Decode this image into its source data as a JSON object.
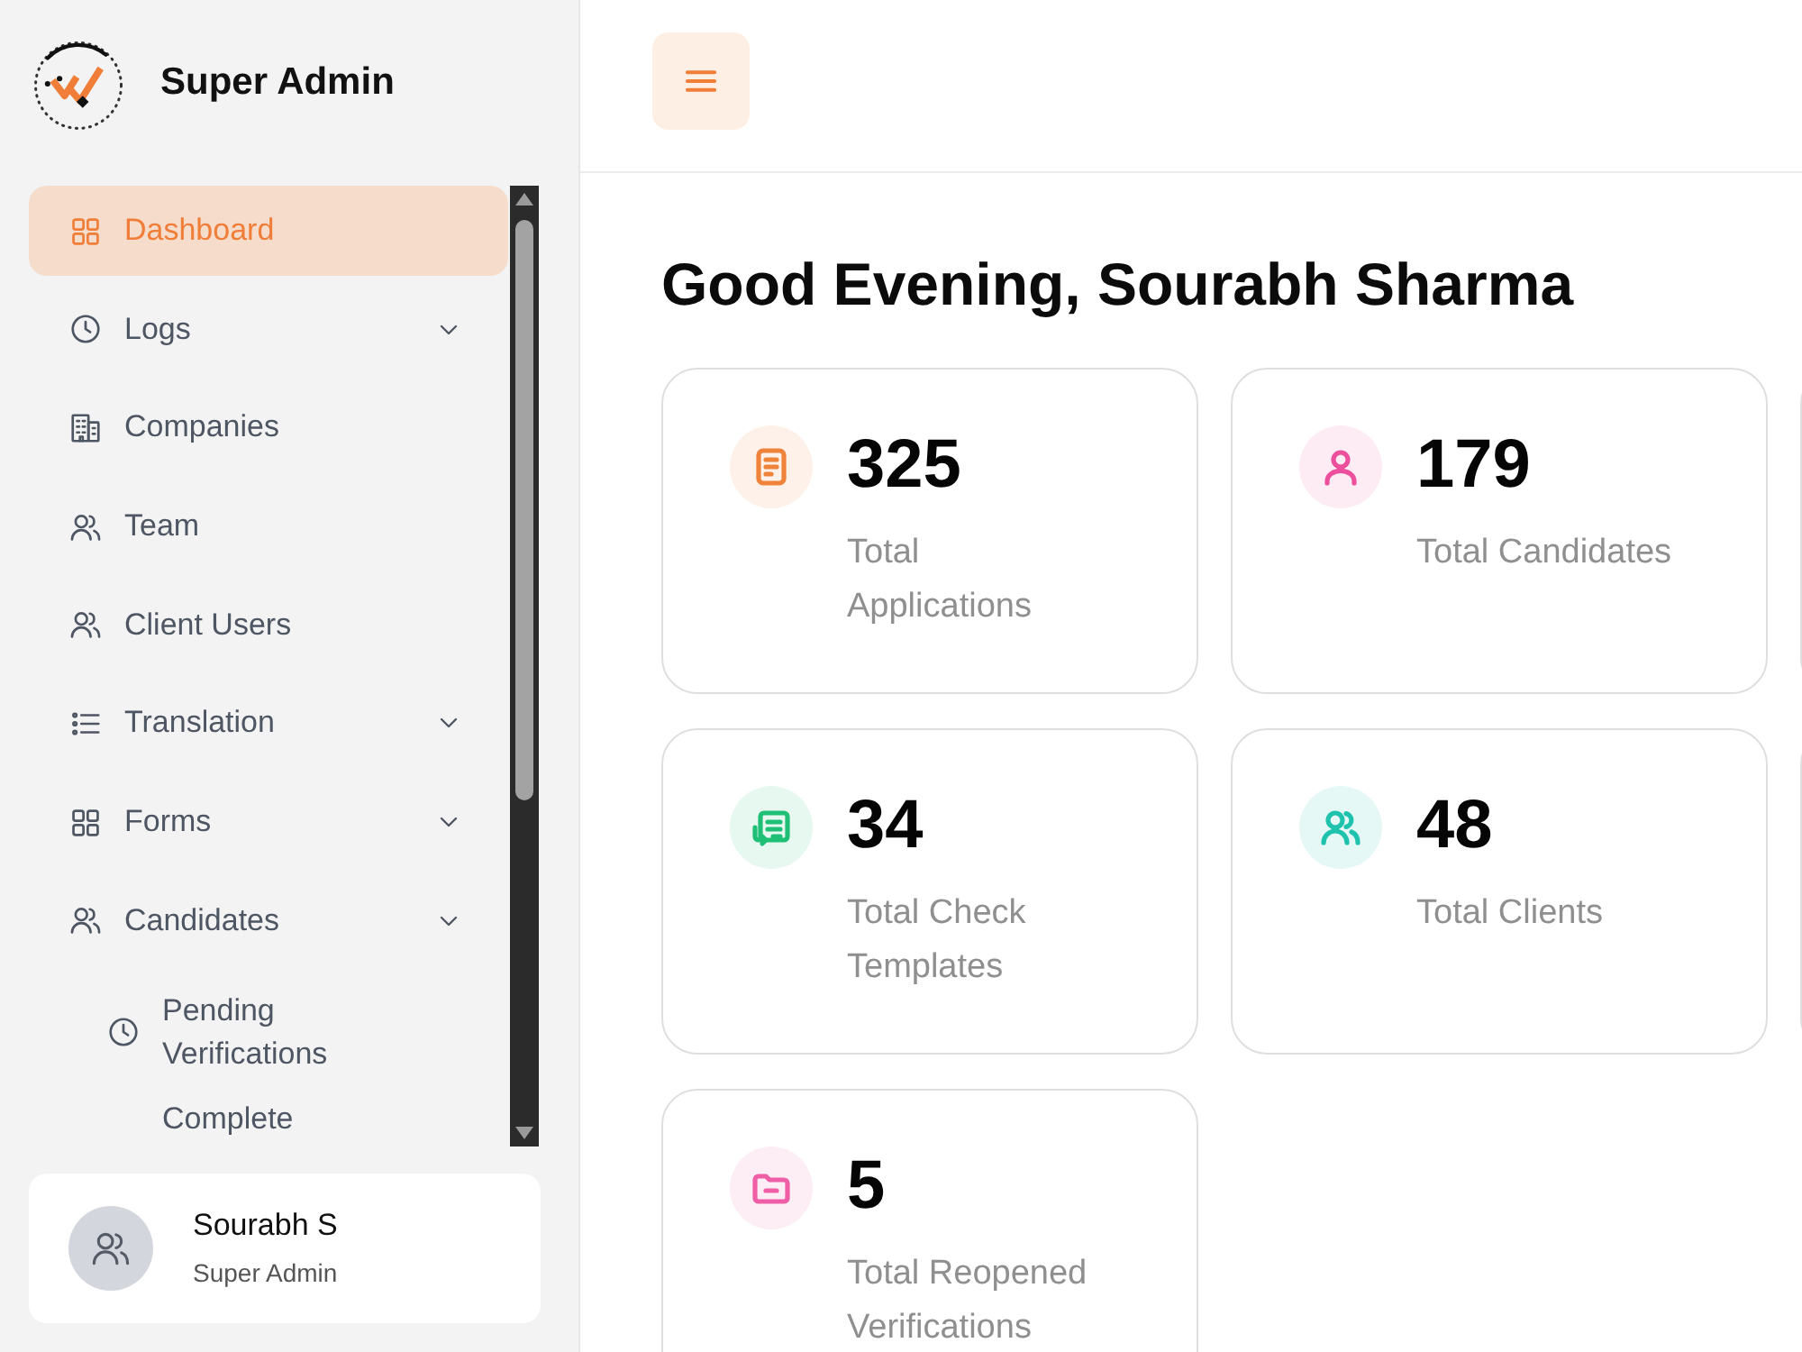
{
  "sidebar": {
    "brand": {
      "title": "Super Admin"
    },
    "nav": [
      {
        "label": "Dashboard",
        "kind": "link",
        "selected": true
      },
      {
        "label": "Logs",
        "kind": "menu",
        "selected": false
      },
      {
        "label": "Companies",
        "kind": "link",
        "selected": false
      },
      {
        "label": "Team",
        "kind": "link",
        "selected": false
      },
      {
        "label": "Client Users",
        "kind": "link",
        "selected": false
      },
      {
        "label": "Translation",
        "kind": "menu",
        "selected": false
      },
      {
        "label": "Forms",
        "kind": "menu",
        "selected": false
      },
      {
        "label": "Candidates",
        "kind": "menu",
        "selected": false,
        "children": [
          {
            "label": "Pending Verifications",
            "selected": false
          },
          {
            "label": "Complete",
            "selected": false
          }
        ]
      }
    ],
    "user": {
      "name": "Sourabh S",
      "role": "Super Admin"
    }
  },
  "greeting": "Good Evening, Sourabh Sharma",
  "stats": [
    {
      "value": "325",
      "label": "Total Applications",
      "color": "#f0833a"
    },
    {
      "value": "179",
      "label": "Total Candidates",
      "color": "#ec4f9c"
    },
    {
      "value": "34",
      "label": "Total Check Templates",
      "color": "#1fbf76"
    },
    {
      "value": "48",
      "label": "Total Clients",
      "color": "#1fc2ad"
    },
    {
      "value": "5",
      "label": "Total Reopened Verifications",
      "color": "#ee5fa7"
    }
  ]
}
